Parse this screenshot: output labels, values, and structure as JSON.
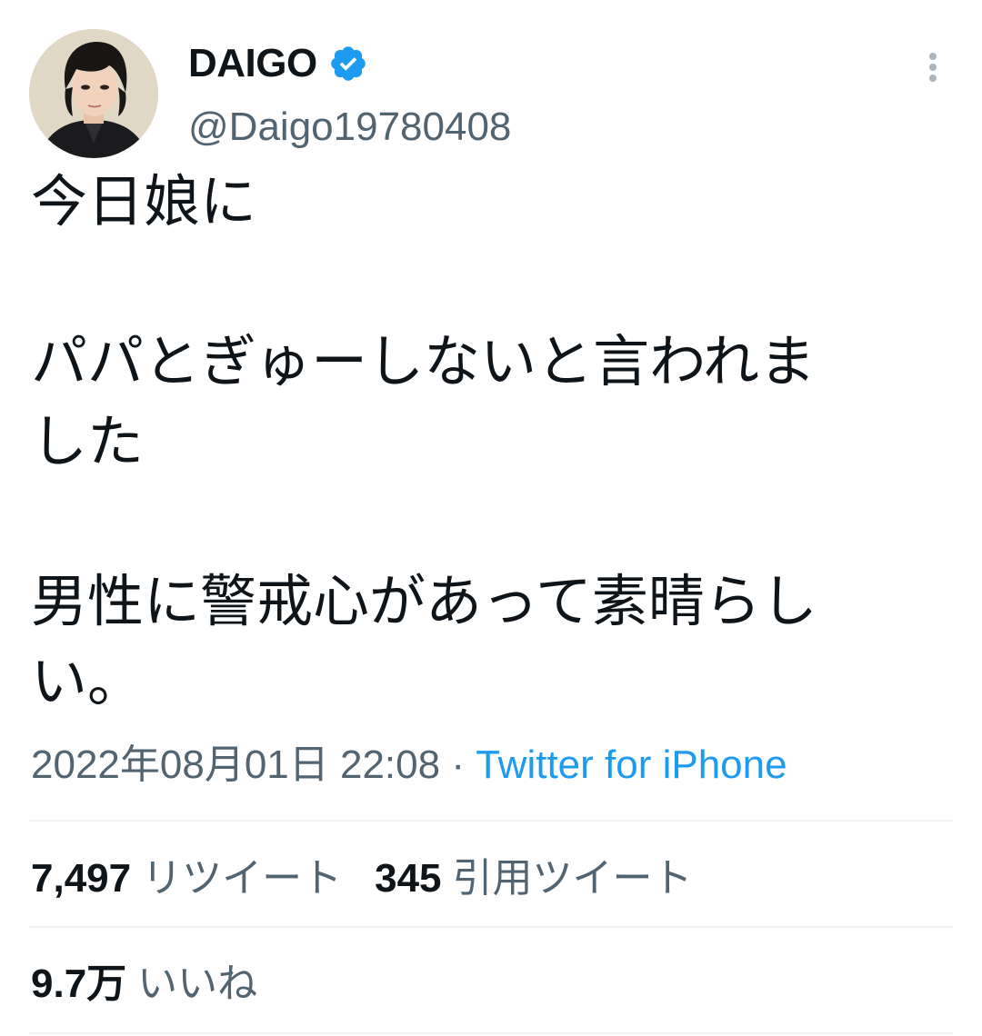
{
  "tweet": {
    "author": {
      "display_name": "DAIGO",
      "handle": "@Daigo19780408",
      "verified_icon": "verified-badge-icon",
      "avatar": "profile-photo"
    },
    "more_icon": "more-vertical-icon",
    "body_lines": [
      "今日娘に",
      "",
      "パパとぎゅーしないと言われま",
      "した",
      "",
      "男性に警戒心があって素晴らし",
      "い。"
    ],
    "timestamp": "2022年08月01日 22:08",
    "separator": " · ",
    "source": "Twitter for iPhone",
    "stats": {
      "retweets_count": "7,497",
      "retweets_label": "リツイート",
      "quotes_count": "345",
      "quotes_label": "引用ツイート",
      "likes_count": "9.7万",
      "likes_label": "いいね"
    }
  },
  "colors": {
    "text_primary": "#0f1419",
    "text_secondary": "#536471",
    "link": "#1d9bf0",
    "verified": "#1d9bf0",
    "divider": "#eff3f4"
  }
}
